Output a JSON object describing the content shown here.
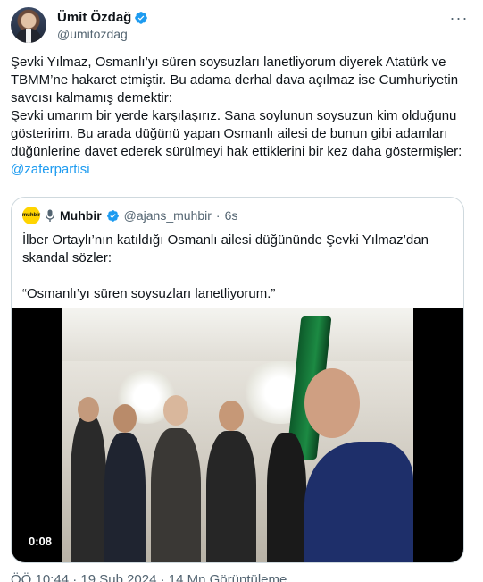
{
  "author": {
    "name": "Ümit Özdağ",
    "handle": "@umitozdag"
  },
  "tweet": {
    "lines_1": "Şevki Yılmaz, Osmanlı’yı süren soysuzları lanetliyorum diyerek Atatürk ve TBMM’ne hakaret etmiştir. Bu adama derhal dava açılmaz ise Cumhuriyetin savcısı kalmamış demektir:",
    "lines_2": "Şevki umarım bir yerde karşılaşırız. Sana soylunun soysuzun kim olduğunu gösteririm. Bu arada düğünü yapan Osmanlı ailesi de bunun gibi adamları düğünlerine davet ederek sürülmeyi hak ettiklerini bir kez daha göstermişler: ",
    "mention": "@zaferpartisi"
  },
  "quote": {
    "logo_text": "muhbir",
    "name": "Muhbir",
    "handle": "@ajans_muhbir",
    "separator": "·",
    "time": "6s",
    "text_1": "İlber Ortaylı’nın katıldığı Osmanlı ailesi düğününde Şevki Yılmaz’dan skandal sözler:",
    "text_2": "“Osmanlı’yı süren soysuzları lanetliyorum.”",
    "video_time": "0:08"
  },
  "footer": {
    "meta": "ÖÖ 10:44 · 19 Şub 2024 · 14 Mn Görüntüleme"
  },
  "colors": {
    "accent": "#1d9bf0",
    "muted": "#536471",
    "text": "#0f1419"
  }
}
